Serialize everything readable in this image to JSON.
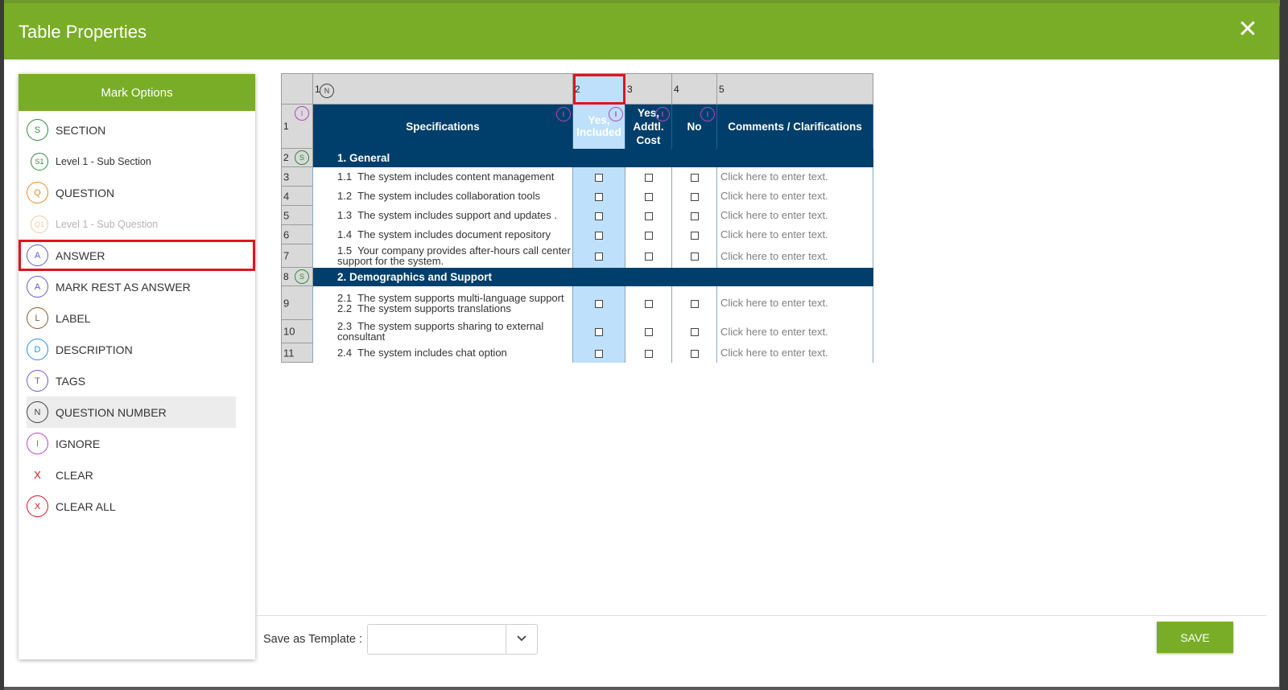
{
  "dialog": {
    "title": "Table Properties"
  },
  "mark_options": {
    "title": "Mark Options",
    "items": [
      {
        "icon": "S",
        "label": "SECTION"
      },
      {
        "icon": "S1",
        "label": "Level 1 - Sub Section"
      },
      {
        "icon": "Q",
        "label": "QUESTION"
      },
      {
        "icon": "Q1",
        "label": "Level 1 - Sub Question"
      },
      {
        "icon": "A",
        "label": "ANSWER"
      },
      {
        "icon": "A",
        "label": "MARK REST AS ANSWER"
      },
      {
        "icon": "L",
        "label": "LABEL"
      },
      {
        "icon": "D",
        "label": "DESCRIPTION"
      },
      {
        "icon": "T",
        "label": "TAGS"
      },
      {
        "icon": "N",
        "label": "QUESTION NUMBER"
      },
      {
        "icon": "I",
        "label": "IGNORE"
      },
      {
        "icon": "X",
        "label": "CLEAR"
      },
      {
        "icon": "X",
        "label": "CLEAR ALL"
      }
    ]
  },
  "table": {
    "col_numbers": [
      "1",
      "2",
      "3",
      "4",
      "5"
    ],
    "col_markers": {
      "n": "N",
      "i": "I",
      "s": "S"
    },
    "row_numbers": [
      "1",
      "2",
      "3",
      "4",
      "5",
      "6",
      "7",
      "8",
      "9",
      "10",
      "11"
    ],
    "headers": [
      "Specifications",
      "Yes, Included",
      "Yes, Addtl. Cost",
      "No",
      "Comments / Clarifications"
    ],
    "sections": [
      "1.  General",
      "2.  Demographics and Support"
    ],
    "rows": [
      {
        "num": "1.1",
        "text": "The system includes content management",
        "comment": "Click here to enter text."
      },
      {
        "num": "1.2",
        "text": "The system includes collaboration tools",
        "comment": "Click here to enter text."
      },
      {
        "num": "1.3",
        "text": "The system includes support and updates .",
        "comment": "Click here to enter text."
      },
      {
        "num": "1.4",
        "text": "The system includes document repository",
        "comment": "Click here to enter text."
      },
      {
        "num": "1.5",
        "text": "Your company provides after-hours call center support for the system.",
        "comment": "Click here to enter text."
      },
      {
        "num": "2.1",
        "text": "The system supports multi-language support",
        "comment": "Click here to enter text."
      },
      {
        "num": "2.2",
        "text": "The system supports translations",
        "comment": ""
      },
      {
        "num": "2.3",
        "text": "The system supports sharing to external consultant",
        "comment": "Click here to enter text."
      },
      {
        "num": "2.4",
        "text": "The system includes chat option",
        "comment": "Click here to enter text."
      }
    ]
  },
  "footer": {
    "template_label": "Save as Template :",
    "template_value": "",
    "save_label": "SAVE"
  },
  "colors": {
    "brand_green": "#79ad28",
    "header_navy": "#003f6b",
    "selected_column": "#bfe0fb",
    "highlight_red": "#e0141e"
  }
}
